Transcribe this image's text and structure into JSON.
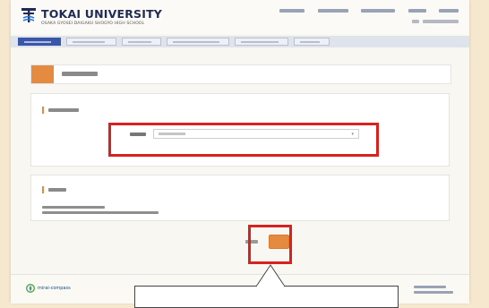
{
  "header": {
    "brand": "TOKAI UNIVERSITY",
    "brand_sub": "OSAKA GYOSEI DAIGAKU SHOGYO HIGH SCHOOL",
    "links": [
      "",
      "",
      "",
      "",
      ""
    ],
    "sub_links": [
      "",
      ""
    ]
  },
  "steps": [
    {
      "label": "",
      "active": true
    },
    {
      "label": "",
      "active": false
    },
    {
      "label": "",
      "active": false
    },
    {
      "label": "",
      "active": false
    },
    {
      "label": "",
      "active": false
    },
    {
      "label": "",
      "active": false
    }
  ],
  "page": {
    "step_badge": "",
    "title": ""
  },
  "section1": {
    "title": "",
    "form_label": "",
    "select_placeholder": ""
  },
  "section2": {
    "title": "",
    "notice_lines": [
      "",
      ""
    ]
  },
  "buttons": {
    "back": "",
    "next": ""
  },
  "footer": {
    "mirai": "mirai-compass",
    "links": [
      "",
      ""
    ]
  },
  "colors": {
    "accent": "#e58b3f",
    "highlight": "#d9221f",
    "nav_active": "#3a56a8"
  }
}
